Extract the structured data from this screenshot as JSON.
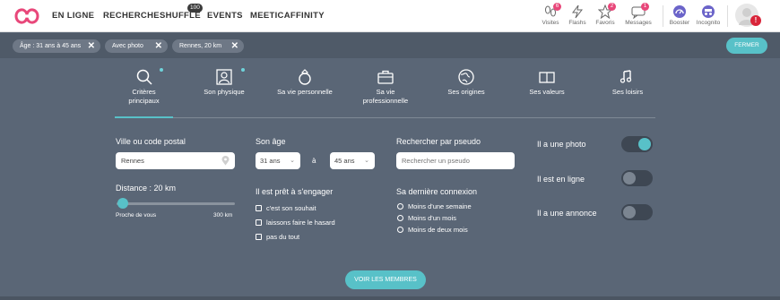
{
  "nav": {
    "items": [
      "EN LIGNE",
      "RECHERCHE",
      "SHUFFLE",
      "EVENTS",
      "MEETICAFFINITY"
    ],
    "shuffle_badge": "100"
  },
  "tools": [
    {
      "label": "Visites",
      "badge": "6",
      "icon": "footprints-icon"
    },
    {
      "label": "Flashs",
      "badge": "",
      "icon": "lightning-icon"
    },
    {
      "label": "Favoris",
      "badge": "2",
      "icon": "star-icon"
    },
    {
      "label": "Messages",
      "badge": "1",
      "icon": "chat-icon"
    },
    {
      "label": "Booster",
      "badge": "",
      "icon": "gauge-icon"
    },
    {
      "label": "Incognito",
      "badge": "",
      "icon": "incognito-icon"
    }
  ],
  "avatar_alert": "!",
  "filters": {
    "chips": [
      "Âge : 31 ans à 45 ans",
      "Avec photo",
      "Rennes, 20 km"
    ],
    "close_label": "FERMER"
  },
  "tabs": [
    {
      "label": "Critères principaux",
      "icon": "search-icon"
    },
    {
      "label": "Son physique",
      "icon": "portrait-icon"
    },
    {
      "label": "Sa vie personnelle",
      "icon": "ring-icon"
    },
    {
      "label": "Sa vie professionnelle",
      "icon": "briefcase-icon"
    },
    {
      "label": "Ses origines",
      "icon": "globe-icon"
    },
    {
      "label": "Ses valeurs",
      "icon": "book-icon"
    },
    {
      "label": "Ses loisirs",
      "icon": "music-icon"
    }
  ],
  "form": {
    "city_label": "Ville ou code postal",
    "city_value": "Rennes",
    "distance_label": "Distance : 20 km",
    "distance_min": "Proche de vous",
    "distance_max": "300 km",
    "age_label": "Son âge",
    "age_from": "31 ans",
    "age_sep": "à",
    "age_to": "45 ans",
    "engage_label": "Il est prêt à s'engager",
    "engage_options": [
      "c'est son souhait",
      "laissons faire le hasard",
      "pas du tout"
    ],
    "pseudo_label": "Rechercher par pseudo",
    "pseudo_placeholder": "Rechercher un pseudo",
    "last_conn_label": "Sa dernière connexion",
    "last_conn_options": [
      "Moins d'une semaine",
      "Moins d'un mois",
      "Moins de deux mois"
    ],
    "toggles": [
      {
        "label": "Il a une photo",
        "on": true
      },
      {
        "label": "Il est en ligne",
        "on": false
      },
      {
        "label": "Il a une annonce",
        "on": false
      }
    ]
  },
  "submit_label": "VOIR LES MEMBRES",
  "colors": {
    "accent": "#58c1c8",
    "brand": "#e8477a",
    "panel": "#5a6676"
  }
}
